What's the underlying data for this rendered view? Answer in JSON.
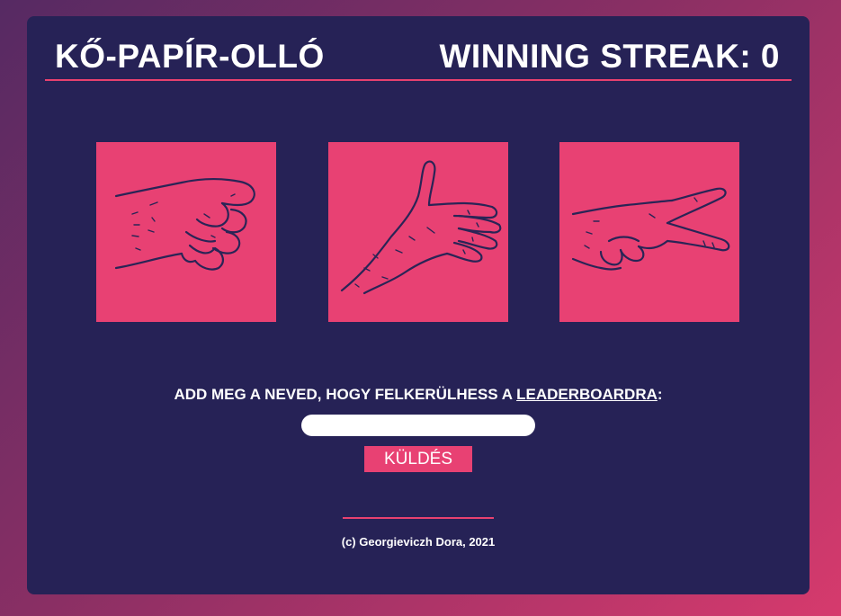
{
  "header": {
    "title": "KŐ-PAPÍR-OLLÓ",
    "streak_label": "WINNING STREAK: 0"
  },
  "choices": [
    {
      "name": "rock",
      "icon": "fist-hand-icon"
    },
    {
      "name": "paper",
      "icon": "open-hand-icon"
    },
    {
      "name": "scissors",
      "icon": "scissors-hand-icon"
    }
  ],
  "leaderboard": {
    "prompt_before": "ADD MEG A NEVED, HOGY FELKERÜLHESS A ",
    "prompt_link": "LEADERBOARDRA",
    "prompt_after": ":",
    "input_value": "",
    "input_placeholder": "",
    "submit_label": "KÜLDÉS"
  },
  "footer": {
    "copyright": "(c) Georgieviczh Dora, 2021"
  },
  "colors": {
    "accent": "#e84173",
    "card": "#262256",
    "text": "#ffffff"
  }
}
